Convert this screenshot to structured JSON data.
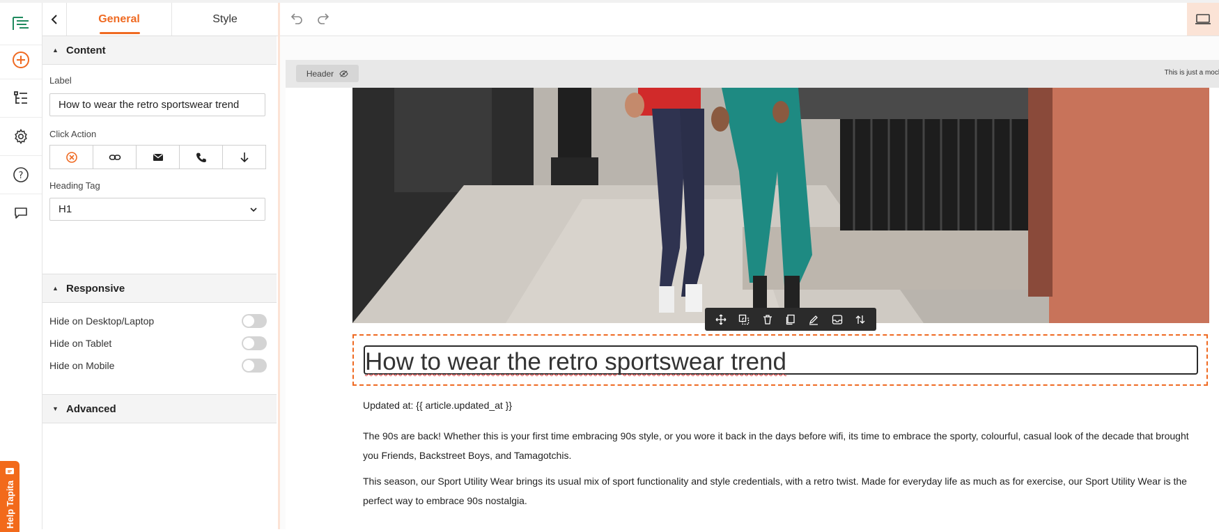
{
  "tabs": {
    "general": "General",
    "style": "Style"
  },
  "content": {
    "section_title": "Content",
    "label_caption": "Label",
    "label_value": "How to wear the retro sportswear trend",
    "click_action_caption": "Click Action",
    "click_actions": [
      "none-icon",
      "link-icon",
      "email-icon",
      "phone-icon",
      "download-icon"
    ],
    "heading_tag_caption": "Heading Tag",
    "heading_tag_value": "H1"
  },
  "responsive": {
    "section_title": "Responsive",
    "items": [
      {
        "label": "Hide on Desktop/Laptop",
        "on": false
      },
      {
        "label": "Hide on Tablet",
        "on": false
      },
      {
        "label": "Hide on Mobile",
        "on": false
      }
    ]
  },
  "advanced": {
    "section_title": "Advanced"
  },
  "help_tab": "Help Tapita",
  "canvas": {
    "header_chip": "Header",
    "mockup_note": "This is just a mockup from your",
    "heading": "How to wear the retro sportswear trend",
    "updated": "Updated at: {{ article.updated_at }}",
    "paragraph1": "The 90s are back! Whether this is your first time embracing 90s style, or you wore it back in the days before wifi, its time to embrace the sporty, colourful, casual look of the decade that brought you Friends, Backstreet Boys, and Tamagotchis.",
    "paragraph2": "This season, our Sport Utility Wear brings its usual mix of sport functionality and style credentials, with a retro twist. Made for everyday life as much as for exercise, our Sport Utility Wear is the perfect way to embrace 90s nostalgia."
  },
  "colors": {
    "accent": "#ef6a22",
    "toolbar": "#2b2b2b",
    "logo": "#1f8a5e"
  }
}
